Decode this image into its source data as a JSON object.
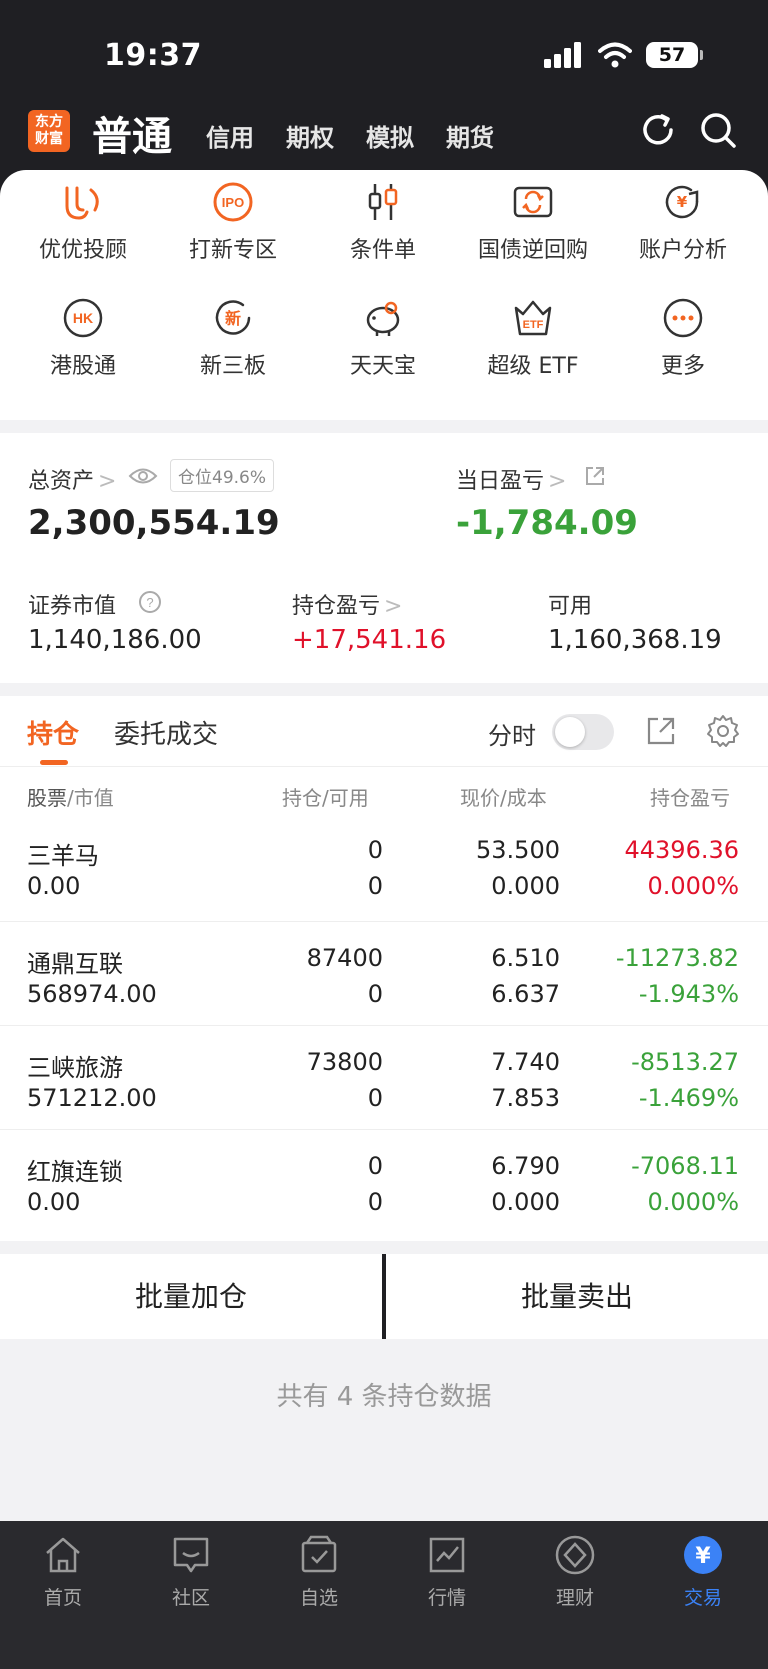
{
  "status": {
    "time": "19:37",
    "battery": "57"
  },
  "nav": {
    "logo": "东方财富",
    "tab_active": "普通",
    "tabs": [
      "信用",
      "期权",
      "模拟",
      "期货"
    ]
  },
  "shortcuts": [
    {
      "label": "优优投顾",
      "icon": "youyou-icon"
    },
    {
      "label": "打新专区",
      "icon": "ipo-icon",
      "icon_text": "IPO"
    },
    {
      "label": "条件单",
      "icon": "condition-order-icon"
    },
    {
      "label": "国债逆回购",
      "icon": "bond-repo-icon"
    },
    {
      "label": "账户分析",
      "icon": "account-analysis-icon"
    },
    {
      "label": "港股通",
      "icon": "hk-connect-icon",
      "icon_text": "HK"
    },
    {
      "label": "新三板",
      "icon": "neeq-icon",
      "icon_text": "新"
    },
    {
      "label": "天天宝",
      "icon": "piggy-bank-icon"
    },
    {
      "label": "超级 ETF",
      "icon": "etf-icon",
      "icon_text": "ETF"
    },
    {
      "label": "更多",
      "icon": "more-icon"
    }
  ],
  "assets": {
    "total_label": "总资产",
    "position_badge": "仓位49.6%",
    "total_value": "2,300,554.19",
    "daily_pl_label": "当日盈亏",
    "daily_pl_value": "-1,784.09",
    "market_value_label": "证券市值",
    "market_value": "1,140,186.00",
    "holding_pl_label": "持仓盈亏",
    "holding_pl_value": "+17,541.16",
    "available_label": "可用",
    "available_value": "1,160,368.19"
  },
  "holdings": {
    "tab_positions": "持仓",
    "tab_orders": "委托成交",
    "toggle_label": "分时",
    "toggle_on": false,
    "columns": {
      "stock": "股票",
      "stock_sub": "市值",
      "position": "持仓",
      "position_sub": "可用",
      "price": "现价",
      "price_sub": "成本",
      "pl": "持仓盈亏"
    },
    "rows": [
      {
        "name": "三羊马",
        "market_value": "0.00",
        "position": "0",
        "available": "0",
        "price": "53.500",
        "cost": "0.000",
        "pl": "44396.36",
        "pl_pct": "0.000%",
        "dir": "up"
      },
      {
        "name": "通鼎互联",
        "market_value": "568974.00",
        "position": "87400",
        "available": "0",
        "price": "6.510",
        "cost": "6.637",
        "pl": "-11273.82",
        "pl_pct": "-1.943%",
        "dir": "down"
      },
      {
        "name": "三峡旅游",
        "market_value": "571212.00",
        "position": "73800",
        "available": "0",
        "price": "7.740",
        "cost": "7.853",
        "pl": "-8513.27",
        "pl_pct": "-1.469%",
        "dir": "down"
      },
      {
        "name": "红旗连锁",
        "market_value": "0.00",
        "position": "0",
        "available": "0",
        "price": "6.790",
        "cost": "0.000",
        "pl": "-7068.11",
        "pl_pct": "0.000%",
        "dir": "down"
      }
    ]
  },
  "actions": {
    "batch_buy": "批量加仓",
    "batch_sell": "批量卖出"
  },
  "footer": {
    "count_text": "共有 4 条持仓数据"
  },
  "tabbar": [
    {
      "label": "首页",
      "icon": "home-icon"
    },
    {
      "label": "社区",
      "icon": "community-icon"
    },
    {
      "label": "自选",
      "icon": "watchlist-icon"
    },
    {
      "label": "行情",
      "icon": "market-icon"
    },
    {
      "label": "理财",
      "icon": "wealth-icon"
    },
    {
      "label": "交易",
      "icon": "trade-icon",
      "active": true
    }
  ],
  "colors": {
    "accent": "#f26522",
    "up": "#e0112a",
    "down": "#3aa23a",
    "tab_active": "#3b82f6"
  }
}
